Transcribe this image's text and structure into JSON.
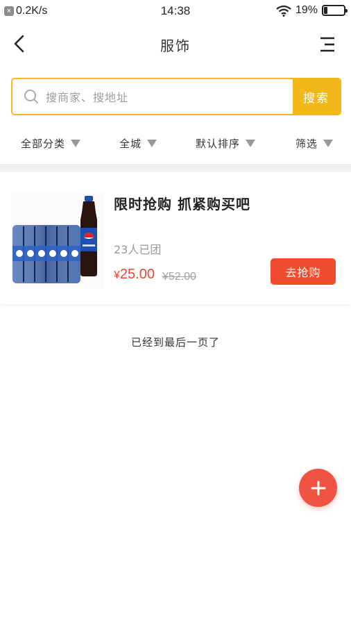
{
  "status_bar": {
    "network_speed": "0.2K/s",
    "time": "14:38",
    "battery_percent": "19%",
    "battery_level": 0.19
  },
  "nav": {
    "title": "服饰"
  },
  "search": {
    "placeholder": "搜商家、搜地址",
    "button_label": "搜索"
  },
  "filters": [
    {
      "label": "全部分类"
    },
    {
      "label": "全城"
    },
    {
      "label": "默认排序"
    },
    {
      "label": "筛选"
    }
  ],
  "product": {
    "title": "限时抢购 抓紧购买吧",
    "group_count": "23人已团",
    "currency": "¥",
    "price": "25.00",
    "original_price": "¥52.00",
    "buy_label": "去抢购"
  },
  "list_end_text": "已经到最后一页了",
  "colors": {
    "accent": "#f4b71a",
    "price": "#e8462f",
    "buy_button": "#f04b2e",
    "fab": "#f05343"
  }
}
